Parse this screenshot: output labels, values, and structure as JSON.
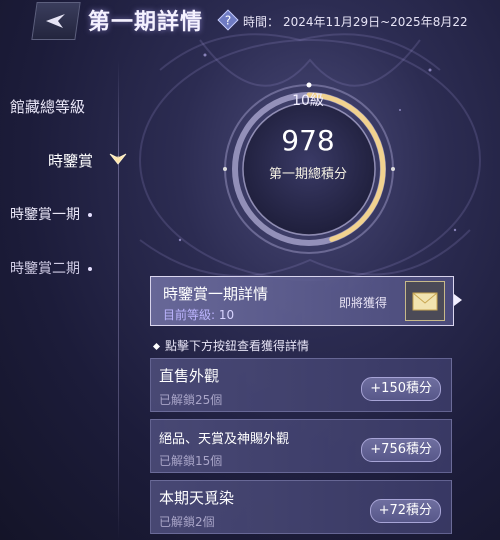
{
  "header": {
    "title": "第一期詳情",
    "period_label": "時間：",
    "period_value": "2024年11月29日~2025年8月22"
  },
  "sidebar": {
    "items": [
      {
        "label": "館藏總等級"
      },
      {
        "label": "時鑒賞"
      },
      {
        "label": "時鑒賞一期"
      },
      {
        "label": "時鑒賞二期"
      }
    ]
  },
  "level": {
    "label": "10級",
    "score": "978",
    "score_label": "第一期總積分",
    "progress": 0.45
  },
  "detail": {
    "title": "時鑒賞一期詳情",
    "level_label": "目前等級",
    "level_value": "10",
    "coming_soon": "即將獲得"
  },
  "hint": "點擊下方按鈕查看獲得詳情",
  "rewards": [
    {
      "title": "直售外觀",
      "subtitle": "已解鎖25個",
      "points": "+150積分"
    },
    {
      "title": "絕品、天賞及神賜外觀",
      "subtitle": "已解鎖15個",
      "points": "+756積分"
    },
    {
      "title": "本期天覓染",
      "subtitle": "已解鎖2個",
      "points": "+72積分"
    }
  ],
  "colors": {
    "accent_gold": "#e8c27a",
    "accent_purple": "#bdb5ff"
  }
}
